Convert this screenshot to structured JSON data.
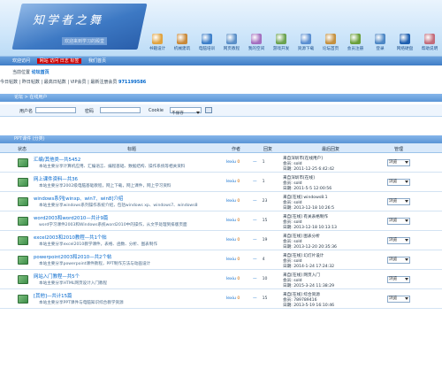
{
  "logo": {
    "title": "知学者之舞",
    "subtitle": "欢迎来到学习的殿堂"
  },
  "nav": [
    {
      "label": "书籍设计",
      "color": "#e0a340"
    },
    {
      "label": "机械建筑",
      "color": "#c8893a"
    },
    {
      "label": "电脑培训",
      "color": "#3d7fc9"
    },
    {
      "label": "网页教程",
      "color": "#5a8fc8"
    },
    {
      "label": "我的空间",
      "color": "#a46fbf"
    },
    {
      "label": "游戏开发",
      "color": "#6aa24f"
    },
    {
      "label": "资源下载",
      "color": "#5b8fd1"
    },
    {
      "label": "论坛首页",
      "color": "#c4903f"
    },
    {
      "label": "会员注册",
      "color": "#6a9f3a"
    },
    {
      "label": "登录",
      "color": "#4d87c5"
    },
    {
      "label": "网络硬盘",
      "color": "#1f5fb0"
    },
    {
      "label": "帮助说明",
      "color": "#c26b7a"
    }
  ],
  "menubar": {
    "text": "欢迎访问",
    "hot": "网站 访问 日志 标签",
    "more": "我们首页"
  },
  "crumb": {
    "prefix": "当前位置",
    "place": "论坛首页"
  },
  "stats": {
    "text": "今日帖数 | 昨日帖数 | 最高日帖数 | VIP会员 | 最新注册会员",
    "latest": "971199586"
  },
  "panel1": "论坛 > 在线用户",
  "search": {
    "user_label": "用户名",
    "pass_label": "密码",
    "cookie_label": "Cookie",
    "cookie_value": "不保存"
  },
  "panel2": "PPT课件 (分类)",
  "table_headers": {
    "state": "状态",
    "title": "标题",
    "author": "作者",
    "reply": "回复",
    "last": "最后回复",
    "manage": "管理"
  },
  "rows": [
    {
      "title": "汇编/其他类—共5452",
      "desc": "本站主要分享计算机应用、汇编语言、编程基础、数据结构、操作系统等相关资料",
      "author": "lexiu",
      "replies": "0",
      "views": "1",
      "l1": "来自深圳市[在线用户]",
      "l2": "会员: sold",
      "l3": "日期: 2011-12-25 6:42:42",
      "manage": "浏览"
    },
    {
      "title": "网上课件资料—共36",
      "desc": "本站主要分享2002级电脑基础教程，网上下载，网上课件，网上学习资料",
      "author": "lexiu",
      "replies": "0",
      "views": "1",
      "l1": "来自深圳市[在线]",
      "l2": "会员: sold",
      "l3": "日期: 2011-5-5 12:00:56",
      "manage": "浏览"
    },
    {
      "title": "windows系列[winxp、win7、win8]介绍",
      "desc": "本站主要分享windows系列操作系统介绍，包括windows xp、windows7、windows8",
      "author": "lexiu",
      "replies": "0",
      "views": "23",
      "l1": "来自[在线] windows8.1",
      "l2": "会员: sold",
      "l3": "日期: 2013-12-18 10:26:5",
      "manage": "浏览"
    },
    {
      "title": "word2003和word2010—共计9篇",
      "desc": "word学习课件2003和Windows系统word2010中的操作，从文字处理到排版页面",
      "author": "lexiu",
      "replies": "0",
      "views": "15",
      "l1": "来自[在线] 有关表格制作",
      "l2": "会员: sold",
      "l3": "日期: 2013-12-18 10:13:13",
      "manage": "浏览"
    },
    {
      "title": "excel2003和2010教程—共1个帖",
      "desc": "本站主要分享excel2010教学课件，表格、函数、分析、图表制作",
      "author": "lexiu",
      "replies": "0",
      "views": "19",
      "l1": "来自[在线] 图表分析",
      "l2": "会员: sold",
      "l3": "日期: 2013-12-20 20:35:36",
      "manage": "浏览"
    },
    {
      "title": "powerpoint2003和2010—共2个帖",
      "desc": "本站主要分享powerpoint课件教程，PPT制作方法与动画设计",
      "author": "lexiu",
      "replies": "0",
      "views": "4",
      "l1": "来自[在线] 幻灯片设计",
      "l2": "会员: sold",
      "l3": "日期: 2014-1-24 17:24:32",
      "manage": "浏览"
    },
    {
      "title": "网站入门教程—共5个",
      "desc": "本站主要分享HTML网页设计入门教程",
      "author": "lexiu",
      "replies": "0",
      "views": "10",
      "l1": "来自[在线] 网页入门",
      "l2": "会员: sold",
      "l3": "日期: 2015-3-24 11:38:29",
      "manage": "浏览"
    },
    {
      "title": "[其他]—共计15篇",
      "desc": "本站主要分享PPT课件与电脑知识综合教学资源",
      "author": "lexiu",
      "replies": "0",
      "views": "15",
      "l1": "来自[在线] 综合资源",
      "l2": "会员: 789789416",
      "l3": "日期: 2013-5-19 16:10:46",
      "manage": "浏览"
    }
  ]
}
